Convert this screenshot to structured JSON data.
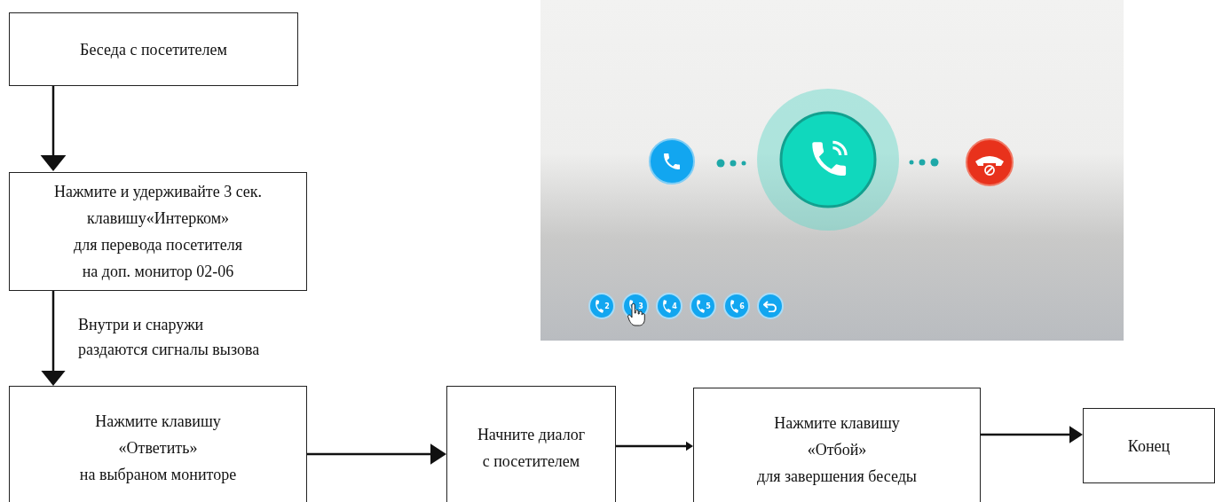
{
  "flow": {
    "nodes": [
      {
        "kind": "step",
        "text": "Беседа с посетителем"
      },
      {
        "kind": "step",
        "text": "Нажмите и удерживайте 3 сек.\nклавишу«Интерком»\nдля перевода посетителя\nна доп. монитор 02-06"
      },
      {
        "kind": "step",
        "text": "Нажмите клавишу\n«Ответить»\nна выбраном мониторе"
      },
      {
        "kind": "step",
        "text": "Начните диалог\nс посетителем"
      },
      {
        "kind": "step",
        "text": "Нажмите клавишу\n«Отбой»\nдля завершения беседы"
      },
      {
        "kind": "end",
        "text": "Конец"
      }
    ],
    "note": "Внутри и снаружи\nраздаются сигналы вызова"
  },
  "screen": {
    "monitor_buttons": [
      {
        "kind": "monitor",
        "label": "2",
        "selected": false
      },
      {
        "kind": "monitor",
        "label": "3",
        "selected": true
      },
      {
        "kind": "monitor",
        "label": "4",
        "selected": false
      },
      {
        "kind": "monitor",
        "label": "5",
        "selected": false
      },
      {
        "kind": "monitor",
        "label": "6",
        "selected": false
      },
      {
        "kind": "back",
        "selected": false
      }
    ]
  }
}
